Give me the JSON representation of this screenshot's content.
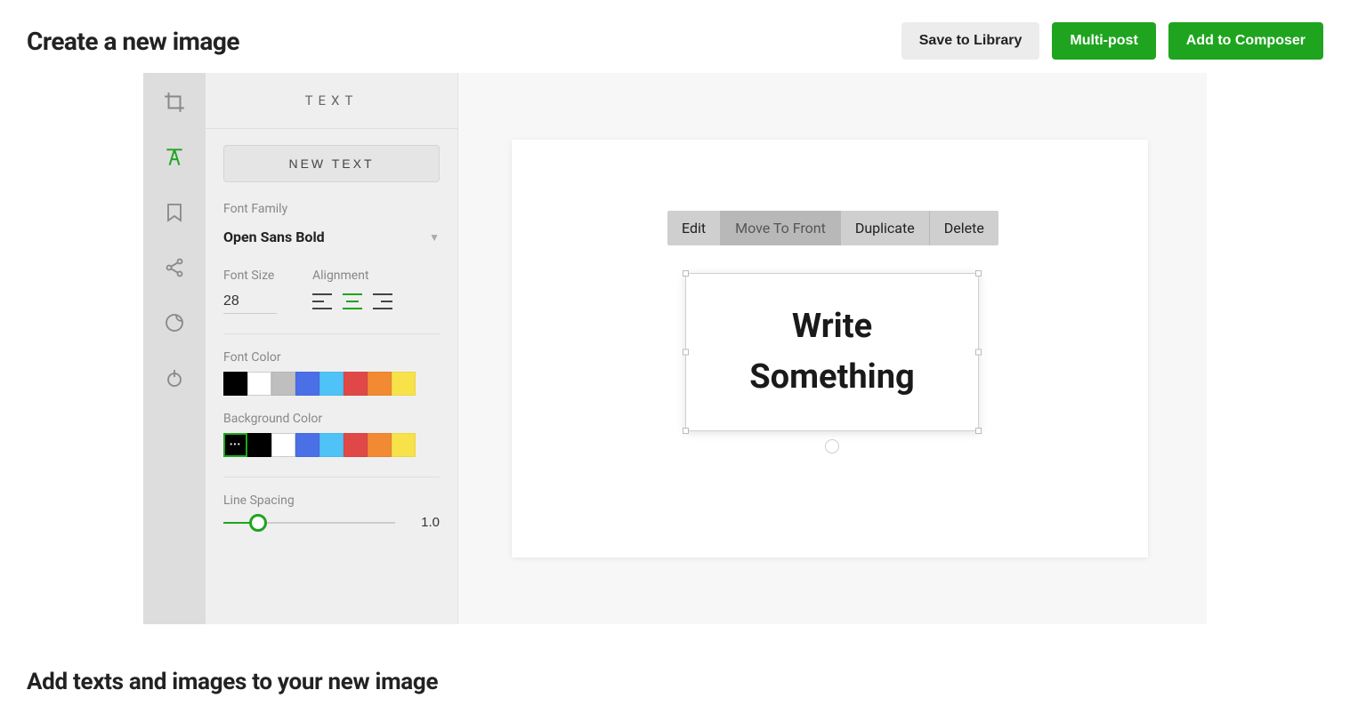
{
  "header": {
    "title": "Create a new image",
    "save": "Save to Library",
    "multipost": "Multi-post",
    "compose": "Add to Composer"
  },
  "panel": {
    "title": "TEXT",
    "new_text": "NEW TEXT",
    "font_family_label": "Font Family",
    "font_family_value": "Open Sans Bold",
    "font_size_label": "Font Size",
    "font_size_value": "28",
    "alignment_label": "Alignment",
    "font_color_label": "Font Color",
    "bg_color_label": "Background Color",
    "line_spacing_label": "Line Spacing",
    "line_spacing_value": "1.0"
  },
  "colors": {
    "font": [
      "#000000",
      "#ffffff",
      "#bfbfbf",
      "#4a6fe6",
      "#4fc3f7",
      "#e04848",
      "#f28a33",
      "#f7e24a"
    ],
    "bg": [
      "#000000",
      "#000000",
      "#ffffff",
      "#4a6fe6",
      "#4fc3f7",
      "#e04848",
      "#f28a33",
      "#f7e24a"
    ]
  },
  "context_toolbar": {
    "edit": "Edit",
    "move_front": "Move To Front",
    "duplicate": "Duplicate",
    "delete": "Delete"
  },
  "canvas_text": "Write\nSomething",
  "footer_heading": "Add texts and images to your new image"
}
